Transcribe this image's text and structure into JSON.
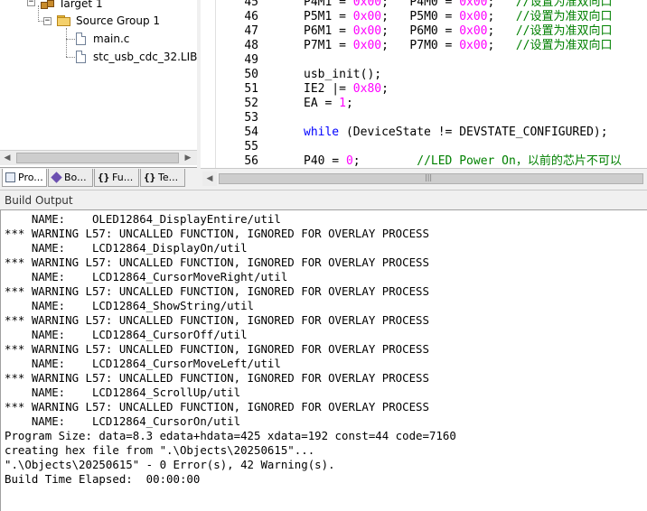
{
  "project": {
    "target_label": "Target 1",
    "group_label": "Source Group 1",
    "files": [
      "main.c",
      "stc_usb_cdc_32.LIB"
    ]
  },
  "panel_tabs": [
    {
      "label": "Pro...",
      "icon": "project-icon"
    },
    {
      "label": "Bo...",
      "icon": "books-icon"
    },
    {
      "label": "Fu...",
      "icon": "functions-icon"
    },
    {
      "label": "Te...",
      "icon": "templates-icon"
    }
  ],
  "editor": {
    "lines": [
      {
        "num": "45",
        "parts": [
          {
            "t": "P4M1 = ",
            "c": ""
          },
          {
            "t": "0x00",
            "c": "num"
          },
          {
            "t": ";   P4M0 = ",
            "c": ""
          },
          {
            "t": "0x00",
            "c": "num"
          },
          {
            "t": ";   ",
            "c": ""
          },
          {
            "t": "//设置为准双向口",
            "c": "cmt"
          }
        ]
      },
      {
        "num": "46",
        "parts": [
          {
            "t": "P5M1 = ",
            "c": ""
          },
          {
            "t": "0x00",
            "c": "num"
          },
          {
            "t": ";   P5M0 = ",
            "c": ""
          },
          {
            "t": "0x00",
            "c": "num"
          },
          {
            "t": ";   ",
            "c": ""
          },
          {
            "t": "//设置为准双向口",
            "c": "cmt"
          }
        ]
      },
      {
        "num": "47",
        "parts": [
          {
            "t": "P6M1 = ",
            "c": ""
          },
          {
            "t": "0x00",
            "c": "num"
          },
          {
            "t": ";   P6M0 = ",
            "c": ""
          },
          {
            "t": "0x00",
            "c": "num"
          },
          {
            "t": ";   ",
            "c": ""
          },
          {
            "t": "//设置为准双向口",
            "c": "cmt"
          }
        ]
      },
      {
        "num": "48",
        "parts": [
          {
            "t": "P7M1 = ",
            "c": ""
          },
          {
            "t": "0x00",
            "c": "num"
          },
          {
            "t": ";   P7M0 = ",
            "c": ""
          },
          {
            "t": "0x00",
            "c": "num"
          },
          {
            "t": ";   ",
            "c": ""
          },
          {
            "t": "//设置为准双向口",
            "c": "cmt"
          }
        ]
      },
      {
        "num": "49",
        "parts": []
      },
      {
        "num": "50",
        "parts": [
          {
            "t": "usb_init();",
            "c": ""
          }
        ]
      },
      {
        "num": "51",
        "parts": [
          {
            "t": "IE2 |= ",
            "c": ""
          },
          {
            "t": "0x80",
            "c": "num"
          },
          {
            "t": ";",
            "c": ""
          }
        ]
      },
      {
        "num": "52",
        "parts": [
          {
            "t": "EA = ",
            "c": ""
          },
          {
            "t": "1",
            "c": "num"
          },
          {
            "t": ";",
            "c": ""
          }
        ]
      },
      {
        "num": "53",
        "parts": []
      },
      {
        "num": "54",
        "parts": [
          {
            "t": "while",
            "c": "kw"
          },
          {
            "t": " (DeviceState != DEVSTATE_CONFIGURED);",
            "c": ""
          }
        ]
      },
      {
        "num": "55",
        "parts": []
      },
      {
        "num": "56",
        "parts": [
          {
            "t": "P40 = ",
            "c": ""
          },
          {
            "t": "0",
            "c": "num"
          },
          {
            "t": ";        ",
            "c": ""
          },
          {
            "t": "//LED Power On，以前的芯片不可以",
            "c": "cmt"
          }
        ]
      }
    ]
  },
  "output": {
    "title": "Build Output",
    "lines": [
      "    NAME:    OLED12864_DisplayEntire/util",
      "*** WARNING L57: UNCALLED FUNCTION, IGNORED FOR OVERLAY PROCESS",
      "    NAME:    LCD12864_DisplayOn/util",
      "*** WARNING L57: UNCALLED FUNCTION, IGNORED FOR OVERLAY PROCESS",
      "    NAME:    LCD12864_CursorMoveRight/util",
      "*** WARNING L57: UNCALLED FUNCTION, IGNORED FOR OVERLAY PROCESS",
      "    NAME:    LCD12864_ShowString/util",
      "*** WARNING L57: UNCALLED FUNCTION, IGNORED FOR OVERLAY PROCESS",
      "    NAME:    LCD12864_CursorOff/util",
      "*** WARNING L57: UNCALLED FUNCTION, IGNORED FOR OVERLAY PROCESS",
      "    NAME:    LCD12864_CursorMoveLeft/util",
      "*** WARNING L57: UNCALLED FUNCTION, IGNORED FOR OVERLAY PROCESS",
      "    NAME:    LCD12864_ScrollUp/util",
      "*** WARNING L57: UNCALLED FUNCTION, IGNORED FOR OVERLAY PROCESS",
      "    NAME:    LCD12864_CursorOn/util",
      "Program Size: data=8.3 edata+hdata=425 xdata=192 const=44 code=7160",
      "creating hex file from \".\\Objects\\20250615\"...",
      "\".\\Objects\\20250615\" - 0 Error(s), 42 Warning(s).",
      "Build Time Elapsed:  00:00:00"
    ]
  }
}
